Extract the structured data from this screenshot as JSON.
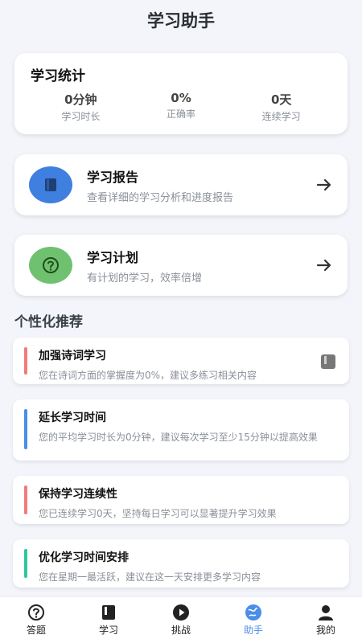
{
  "header": {
    "title": "学习助手"
  },
  "stats": {
    "title": "学习统计",
    "items": [
      {
        "value": "0分钟",
        "label": "学习时长"
      },
      {
        "value": "0%",
        "label": "正确率"
      },
      {
        "value": "0天",
        "label": "连续学习"
      }
    ]
  },
  "features": [
    {
      "title": "学习报告",
      "subtitle": "查看详细的学习分析和进度报告",
      "icon": "book-icon",
      "color": "#3f7fe0"
    },
    {
      "title": "学习计划",
      "subtitle": "有计划的学习，效率倍增",
      "icon": "question-icon",
      "color": "#6fc16f"
    }
  ],
  "recommend": {
    "title": "个性化推荐",
    "items": [
      {
        "title": "加强诗词学习",
        "desc": "您在诗词方面的掌握度为0%，建议多练习相关内容",
        "color": "#f07c7c"
      },
      {
        "title": "延长学习时间",
        "desc": "您的平均学习时长为0分钟，建议每次学习至少15分钟以提高效果",
        "color": "#4a8ee8"
      },
      {
        "title": "保持学习连续性",
        "desc": "您已连续学习0天，坚持每日学习可以显著提升学习效果",
        "color": "#f07c7c"
      },
      {
        "title": "优化学习时间安排",
        "desc": "您在星期一最活跃，建议在这一天安排更多学习内容",
        "color": "#2ec79e"
      }
    ]
  },
  "tabs": [
    {
      "label": "答题",
      "icon": "question-icon"
    },
    {
      "label": "学习",
      "icon": "book-icon"
    },
    {
      "label": "挑战",
      "icon": "play-icon"
    },
    {
      "label": "助手",
      "icon": "globe-icon",
      "active": true
    },
    {
      "label": "我的",
      "icon": "user-icon"
    }
  ]
}
